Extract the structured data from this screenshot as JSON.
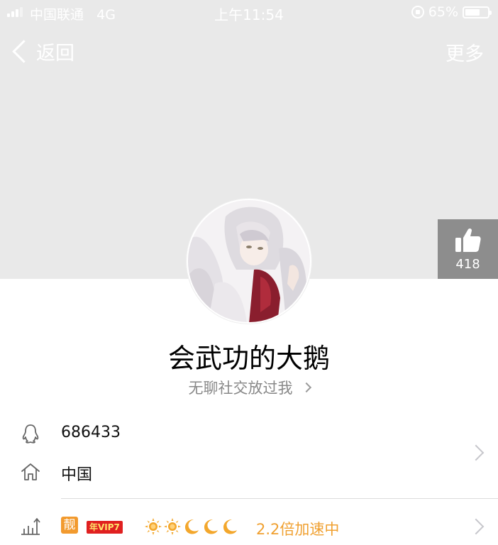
{
  "status_bar": {
    "carrier": "中国联通",
    "network": "4G",
    "time": "上午11:54",
    "battery": "65%",
    "battery_level": 0.65,
    "signal_icon": "signal-icon",
    "rotation_lock_icon": "rotation-lock-icon",
    "battery_icon": "battery-icon"
  },
  "nav": {
    "back_label": "返回",
    "more_label": "更多"
  },
  "like": {
    "count": "418",
    "icon": "thumbs-up-icon"
  },
  "profile": {
    "nickname": "会武功的大鹅",
    "signature": "无聊社交放过我"
  },
  "info": {
    "qq_number": "686433",
    "location": "中国",
    "qq_icon": "penguin-icon",
    "home_icon": "home-icon"
  },
  "vip": {
    "level_icon": "level-chart-icon",
    "liang_badge": "靓",
    "vip_badge": "年VIP7",
    "level_icons": [
      "sun-icon",
      "sun-icon",
      "moon-icon",
      "moon-icon",
      "moon-icon"
    ],
    "speed_text": "2.2倍加速中"
  },
  "colors": {
    "cover_bg": "#e9e9e9",
    "like_bg": "#8d8d8d",
    "accent_orange": "#f0a030",
    "vip_red": "#e02020"
  }
}
